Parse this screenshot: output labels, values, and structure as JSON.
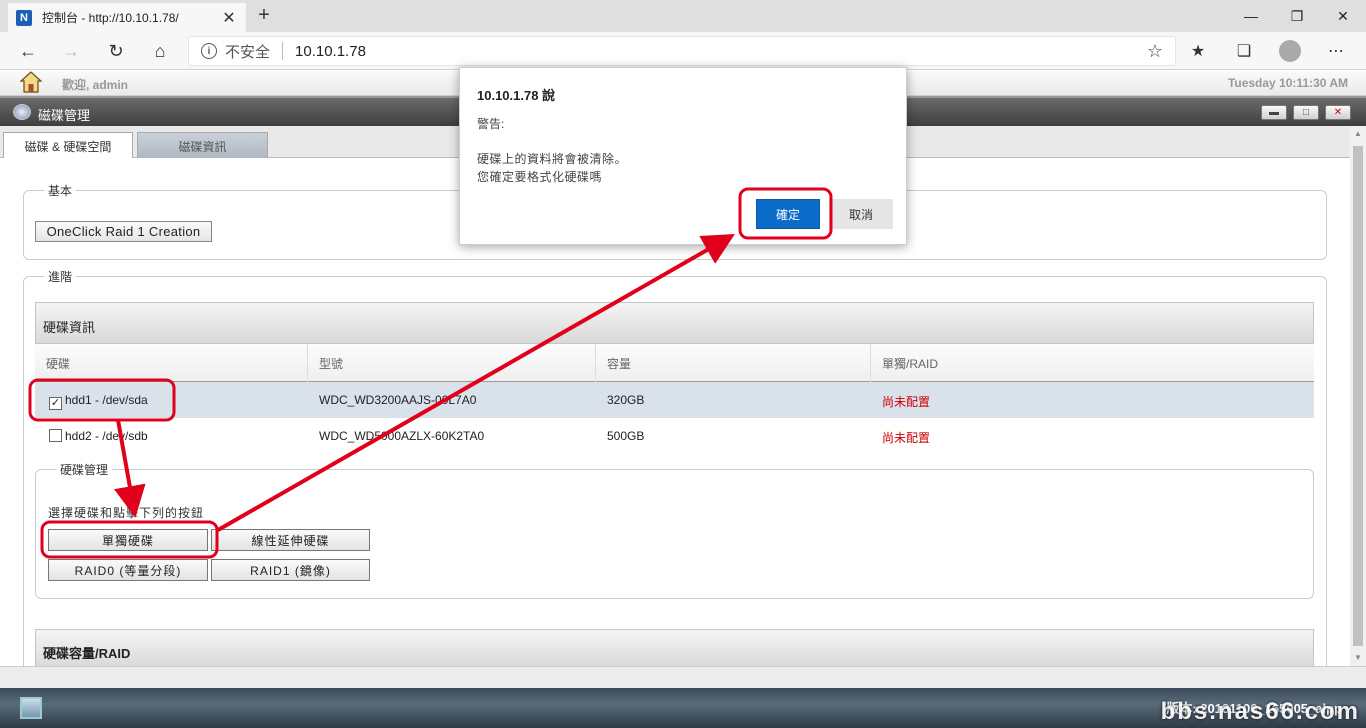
{
  "browser": {
    "tab_title": "控制台 - http://10.10.1.78/",
    "favicon_letter": "N",
    "tab_close": "✕",
    "new_tab": "+",
    "insecure_label": "不安全",
    "url": "10.10.1.78"
  },
  "app": {
    "welcome": "歡迎, admin",
    "datetime": "Tuesday 10:11:30 AM",
    "window_title": "磁碟管理",
    "tabs": [
      {
        "label": "磁碟 & 硬碟空間"
      },
      {
        "label": "磁碟資訊"
      }
    ]
  },
  "basic": {
    "legend": "基本",
    "oneclick_label": "OneClick Raid 1 Creation"
  },
  "advanced": {
    "legend": "進階",
    "disk_info_title": "硬碟資訊",
    "columns": [
      "硬碟",
      "型號",
      "容量",
      "單獨/RAID"
    ],
    "rows": [
      {
        "disk": "hdd1 - /dev/sda",
        "model": "WDC_WD3200AAJS-00L7A0",
        "capacity": "320GB",
        "status": "尚未配置",
        "checked": true
      },
      {
        "disk": "hdd2 - /dev/sdb",
        "model": "WDC_WD5000AZLX-60K2TA0",
        "capacity": "500GB",
        "status": "尚未配置",
        "checked": false
      }
    ],
    "mgmt_legend": "硬碟管理",
    "instruction": "選擇硬碟和點擊下列的按鈕",
    "buttons": {
      "single": "單獨硬碟",
      "linear": "線性延伸硬碟",
      "raid0": "RAID0 (等量分段)",
      "raid1": "RAID1 (鏡像)"
    },
    "capacity_title": "硬碟容量/RAID"
  },
  "footer": {
    "version": "版本: 20181106_165005_alpp",
    "watermark": "bbs.nas66.com"
  },
  "dialog": {
    "title": "10.10.1.78 說",
    "label": "警告:",
    "line1": "硬碟上的資料將會被清除。",
    "line2": "您確定要格式化硬碟嗎",
    "ok": "確定",
    "cancel": "取消"
  },
  "colors": {
    "accent": "#0b6bc8",
    "highlight_red": "#e0001b",
    "status_red": "#cc0000"
  }
}
